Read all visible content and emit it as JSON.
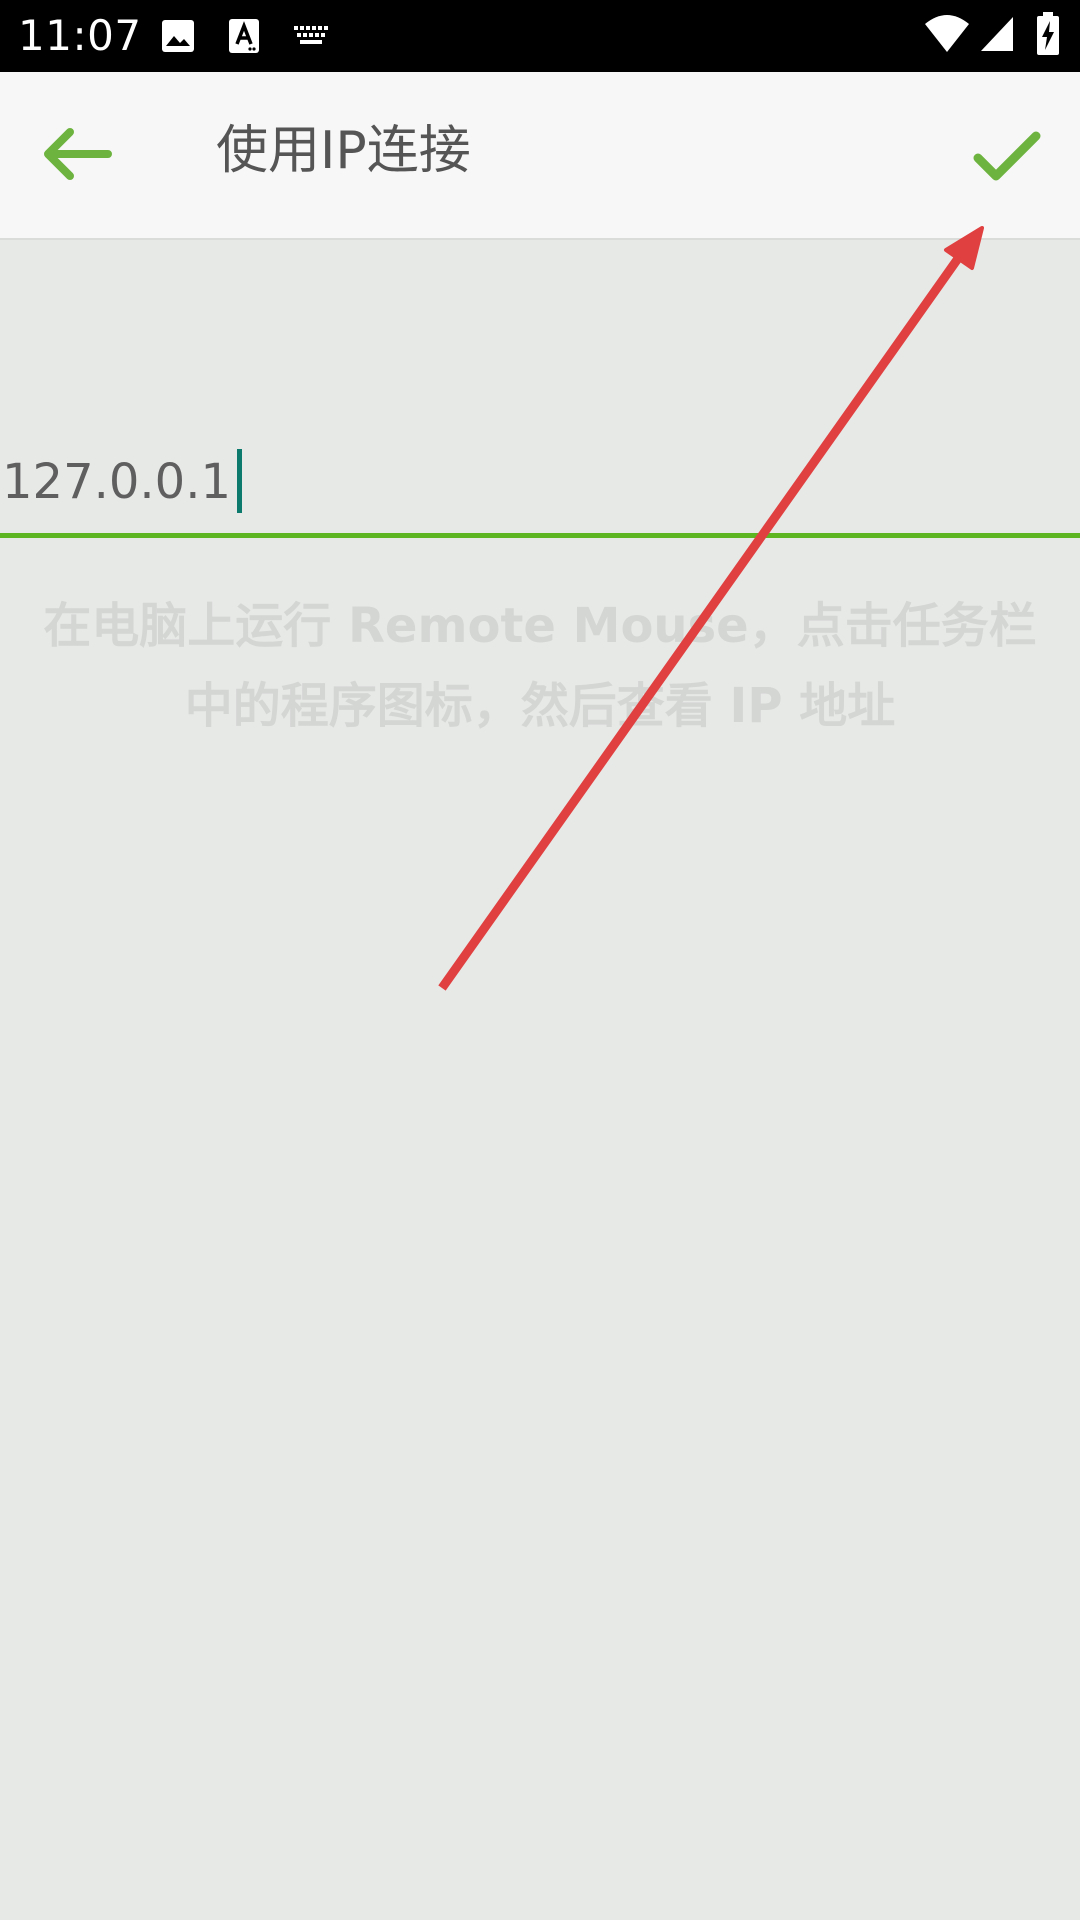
{
  "status_bar": {
    "time": "11:07",
    "left_icons": [
      "image-icon",
      "text-input-icon",
      "keyboard-icon"
    ],
    "right_icons": [
      "wifi-icon",
      "cellular-signal-icon",
      "battery-charging-icon"
    ]
  },
  "app_bar": {
    "title": "使用IP连接",
    "back_icon": "arrow-left-icon",
    "confirm_icon": "checkmark-icon"
  },
  "ip_input": {
    "value": "127.0.0.1"
  },
  "hint": {
    "text": "在电脑上运行 Remote Mouse，点击任务栏中的程序图标，然后查看 IP 地址"
  },
  "colors": {
    "accent_green": "#6db33f",
    "underline_green": "#5db521",
    "cursor_teal": "#0c7b6d",
    "background": "#e7e9e7",
    "annotation_red": "#e04040"
  }
}
